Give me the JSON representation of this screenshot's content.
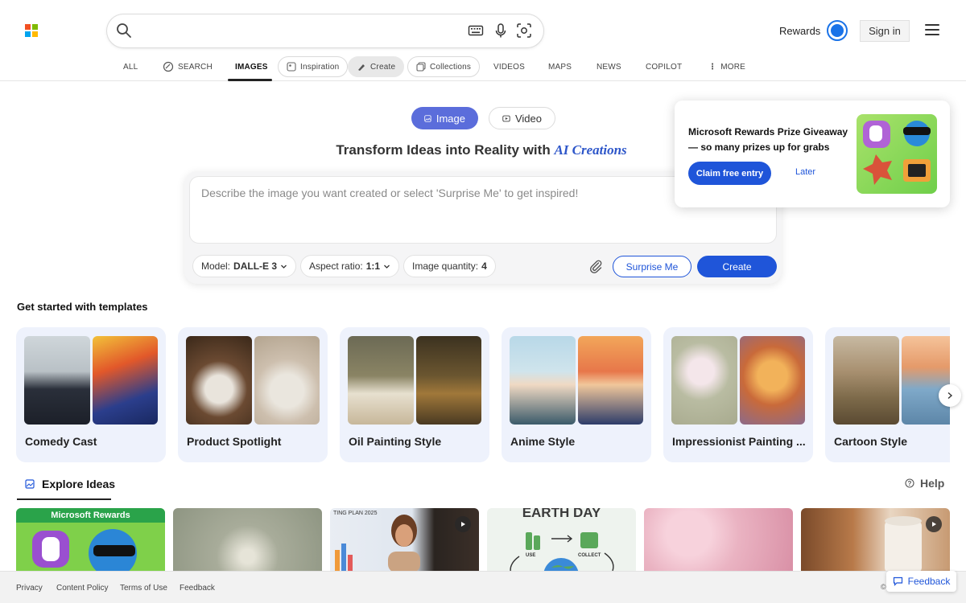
{
  "brand_colors": [
    "#f25022",
    "#7fba00",
    "#00a4ef",
    "#ffb900"
  ],
  "accent": "#1f55d9",
  "search": {
    "value": "",
    "placeholder": ""
  },
  "header": {
    "rewards_label": "Rewards",
    "signin_label": "Sign in"
  },
  "nav": {
    "all": "ALL",
    "search": "SEARCH",
    "images": "IMAGES",
    "inspiration": "Inspiration",
    "create": "Create",
    "collections": "Collections",
    "videos": "VIDEOS",
    "maps": "MAPS",
    "news": "NEWS",
    "copilot": "COPILOT",
    "more": "MORE"
  },
  "creator": {
    "tab_image": "Image",
    "tab_video": "Video",
    "headline": "Transform Ideas into Reality with",
    "headline_accent": "AI Creations",
    "prompt_placeholder": "Describe the image you want created or select 'Surprise Me' to get inspired!",
    "model_label": "Model:",
    "model_value": "DALL-E 3",
    "aspect_label": "Aspect ratio:",
    "aspect_value": "1:1",
    "quantity_label": "Image quantity:",
    "quantity_value": "4",
    "surprise_label": "Surprise Me",
    "create_label": "Create"
  },
  "promo": {
    "title": "Microsoft Rewards Prize Giveaway",
    "subtitle": "— so many prizes up for grabs",
    "claim_label": "Claim free entry",
    "later_label": "Later"
  },
  "templates": {
    "title": "Get started with templates",
    "items": [
      {
        "label": "Comedy Cast"
      },
      {
        "label": "Product Spotlight"
      },
      {
        "label": "Oil Painting Style"
      },
      {
        "label": "Anime Style"
      },
      {
        "label": "Impressionist Painting ..."
      },
      {
        "label": "Cartoon Style"
      }
    ]
  },
  "explore": {
    "title": "Explore Ideas",
    "help_label": "Help",
    "rewards_badge": "Microsoft Rewards",
    "earth_day": "EARTH DAY",
    "plan_text": "TING PLAN 2025",
    "use_text": "USE",
    "collect_text": "COLLECT"
  },
  "footer": {
    "privacy": "Privacy",
    "content_policy": "Content Policy",
    "terms": "Terms of Use",
    "feedback": "Feedback",
    "feedback_button": "Feedback",
    "copyright": "©"
  }
}
